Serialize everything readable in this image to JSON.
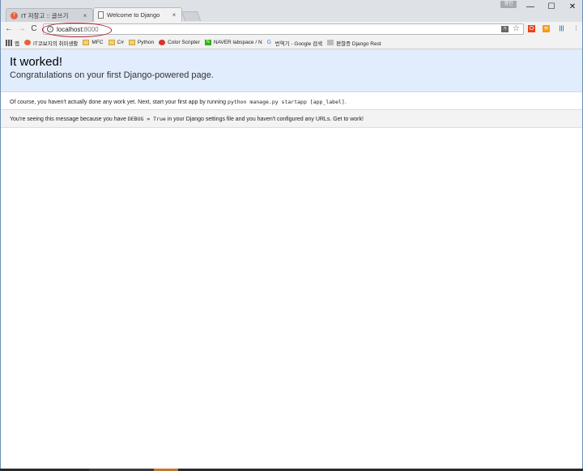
{
  "window": {
    "profile_label": "영진",
    "controls": {
      "minimize": "—",
      "maximize": "☐",
      "close": "✕"
    }
  },
  "tabs": [
    {
      "title": "IT 저장고 :: 글쓰기",
      "favicon": "tistory-icon",
      "close": "×"
    },
    {
      "title": "Welcome to Django",
      "favicon": "document-icon",
      "close": "×"
    }
  ],
  "toolbar": {
    "back": "←",
    "forward": "→",
    "reload": "C",
    "url_host": "localhost:",
    "url_port": "8000",
    "translate": "가",
    "star": "☆",
    "office": "O",
    "rss": "≋",
    "bars": "|||",
    "menu": "⋮"
  },
  "bookmarks": [
    {
      "label": "앱",
      "icon": "apps"
    },
    {
      "label": "IT코보지의 취미생활",
      "icon": "tistory"
    },
    {
      "label": "MFC",
      "icon": "folder"
    },
    {
      "label": "C#",
      "icon": "folder"
    },
    {
      "label": "Python",
      "icon": "folder"
    },
    {
      "label": "Color Scripter",
      "icon": "red"
    },
    {
      "label": "NAVER labspace / N",
      "icon": "naver"
    },
    {
      "label": "번역기 - Google 검색",
      "icon": "google"
    },
    {
      "label": "편찮증 Django Rest",
      "icon": "pages"
    }
  ],
  "page": {
    "title": "It worked!",
    "subtitle": "Congratulations on your first Django-powered page.",
    "instructions_pre": "Of course, you haven't actually done any work yet. Next, start your first app by running ",
    "instructions_code": "python manage.py startapp [app_label]",
    "instructions_post": ".",
    "explanation_pre": "You're seeing this message because you have ",
    "explanation_code": "DEBUG = True",
    "explanation_post": " in your Django settings file and you haven't configured any URLs. Get to work!"
  }
}
